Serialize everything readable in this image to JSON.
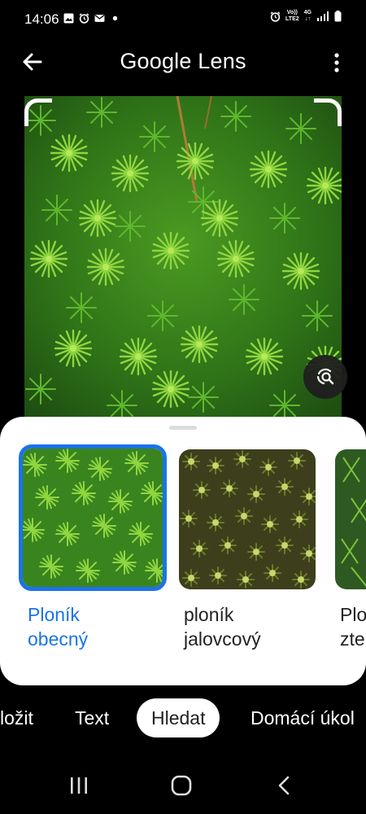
{
  "status_bar": {
    "time": "14:06",
    "network_top": "Vo))",
    "network_bottom": "LTE2",
    "network_type": "4G"
  },
  "app_bar": {
    "title": "Google Lens"
  },
  "results": [
    {
      "label_line1": "Ploník",
      "label_line2": "obecný",
      "selected": true
    },
    {
      "label_line1": "ploník",
      "label_line2": "jalovcový",
      "selected": false
    },
    {
      "label_line1": "Plo",
      "label_line2": "zte",
      "selected": false
    }
  ],
  "tabs": [
    {
      "label": "ložit"
    },
    {
      "label": "Text"
    },
    {
      "label": "Hledat",
      "active": true
    },
    {
      "label": "Domácí úkol"
    }
  ],
  "colors": {
    "accent": "#1a73e8",
    "background": "#000000",
    "sheet": "#ffffff"
  }
}
